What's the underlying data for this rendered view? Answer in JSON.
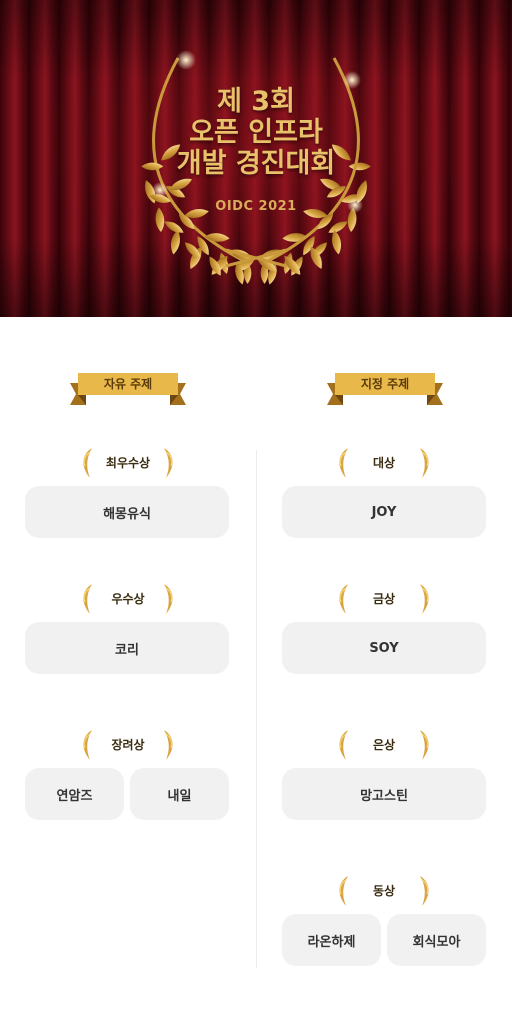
{
  "hero": {
    "title_line1": "제 3회",
    "title_line2": "오픈 인프라",
    "title_line3": "개발 경진대회",
    "subtitle": "OIDC 2021",
    "accent_color": "#e8c26a",
    "curtain_color": "#6a0c16"
  },
  "columns": {
    "left": {
      "ribbon": "자유 주제",
      "awards": [
        {
          "label": "최우수상",
          "teams": [
            "해몽유식"
          ]
        },
        {
          "label": "우수상",
          "teams": [
            "코리"
          ]
        },
        {
          "label": "장려상",
          "teams": [
            "연암즈",
            "내일"
          ]
        }
      ]
    },
    "right": {
      "ribbon": "지정 주제",
      "awards": [
        {
          "label": "대상",
          "teams": [
            "JOY"
          ]
        },
        {
          "label": "금상",
          "teams": [
            "SOY"
          ]
        },
        {
          "label": "은상",
          "teams": [
            "망고스틴"
          ]
        },
        {
          "label": "동상",
          "teams": [
            "라온하제",
            "회식모아"
          ]
        }
      ]
    }
  },
  "icons": {
    "wreath": "laurel-wreath-icon",
    "award_leaf": "laurel-branch-icon",
    "ribbon": "ribbon-banner-icon"
  },
  "colors": {
    "gold": "#d9a542",
    "box_bg": "#f1f1f1",
    "text": "#333333"
  }
}
